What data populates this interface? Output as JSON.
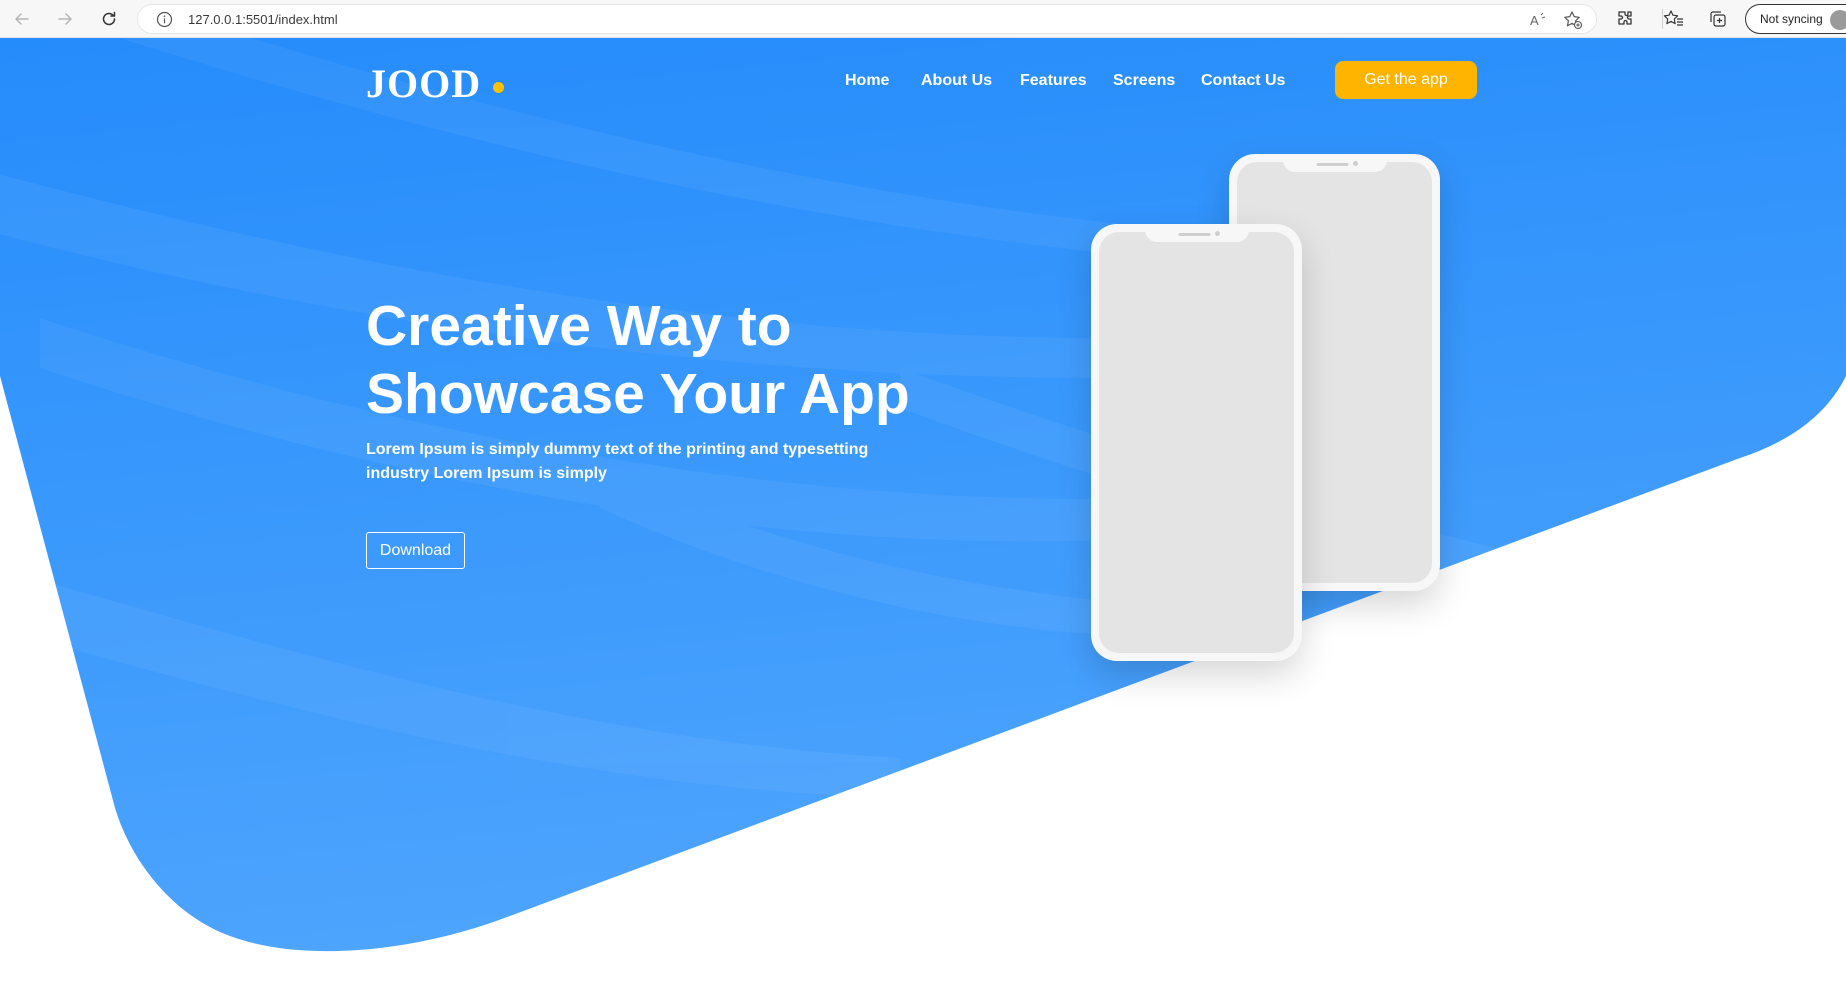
{
  "browser": {
    "url": "127.0.0.1:5501/index.html",
    "sync_label": "Not syncing",
    "read_aloud_label": "A"
  },
  "site": {
    "logo": "JOOD",
    "nav": [
      "Home",
      "About Us",
      "Features",
      "Screens",
      "Contact Us"
    ],
    "cta_label": "Get the app"
  },
  "hero": {
    "title_line1": "Creative Way to",
    "title_line2": "Showcase Your App",
    "subtitle_line1": "Lorem Ipsum is simply dummy text of the printing and typesetting",
    "subtitle_line2": "industry Lorem Ipsum is simply",
    "download_label": "Download"
  },
  "colors": {
    "hero_blue": "#2b8ffb",
    "accent_yellow": "#ffb400",
    "phone_body": "#f7f7f7",
    "phone_screen": "#e4e4e4"
  },
  "icons": [
    "back-icon",
    "forward-icon",
    "reload-icon",
    "info-icon",
    "read-aloud-icon",
    "add-favorite-icon",
    "extensions-icon",
    "favorites-icon",
    "collections-icon",
    "profile-avatar"
  ]
}
